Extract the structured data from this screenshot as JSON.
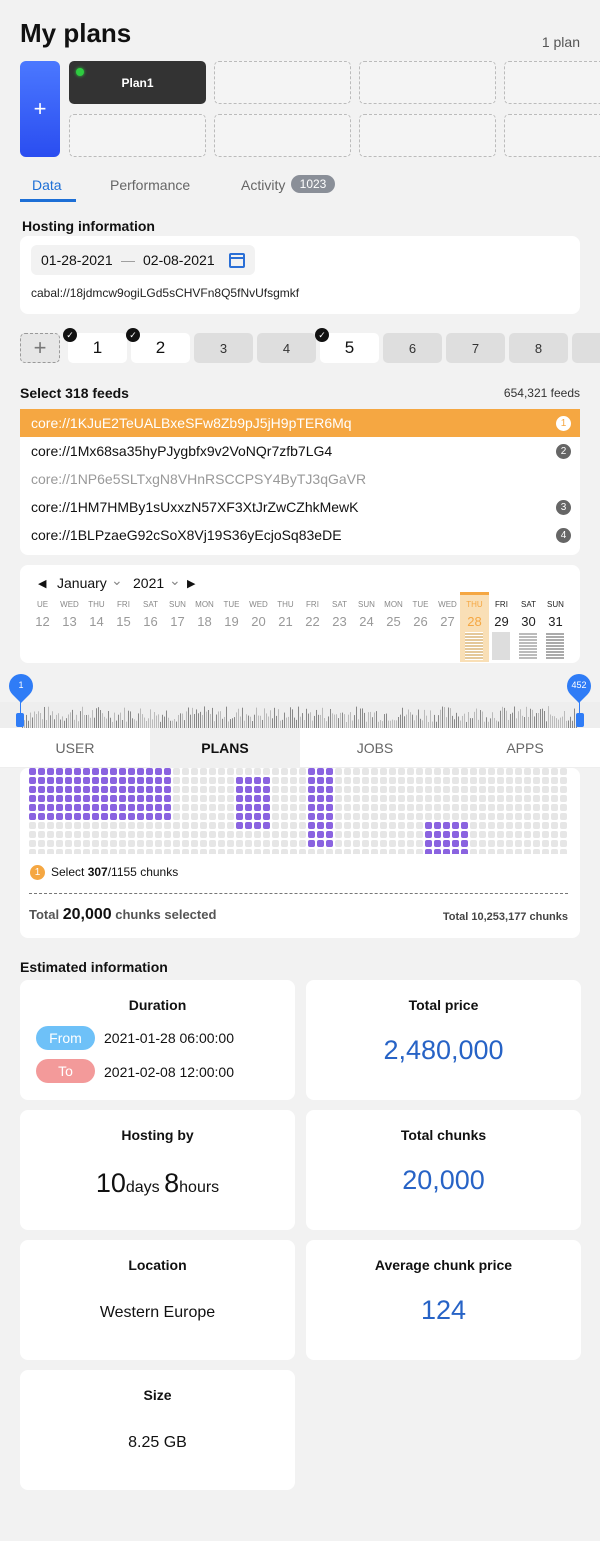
{
  "header": {
    "title": "My plans",
    "count": "1 plan",
    "add_label": "+"
  },
  "plans": {
    "plan1_label": "Plan1"
  },
  "tabs": [
    {
      "label": "Data"
    },
    {
      "label": "Performance"
    },
    {
      "label": "Activity",
      "badge": "1023"
    }
  ],
  "hosting": {
    "title": "Hosting information",
    "date_from": "01-28-2021",
    "date_sep": "—",
    "date_to": "02-08-2021",
    "address": "cabal://18jdmcw9ogiLGd5sCHVFn8Q5fNvUfsgmkf"
  },
  "feed_buttons": {
    "add": "+",
    "labels": [
      "1",
      "2",
      "3",
      "4",
      "5",
      "6",
      "7",
      "8"
    ],
    "checked": [
      true,
      true,
      false,
      false,
      true,
      false,
      false,
      false
    ],
    "check_mark": "✓"
  },
  "feeds": {
    "title": "Select 318 feeds",
    "count": "654,321 feeds",
    "rows": [
      {
        "address": "core://1KJuE2TeUALBxeSFw8Zb9pJ5jH9pTER6Mq",
        "num": "1"
      },
      {
        "address": "core://1Mx68sa35hyPJygbfx9v2VoNQr7zfb7LG4",
        "num": "2"
      },
      {
        "address": "core://1NP6e5SLTxgN8VHnRSCCPSY4ByTJ3qGaVR",
        "num": ""
      },
      {
        "address": "core://1HM7HMBy1sUxxzN57XF3XtJrZwCZhkMewK",
        "num": "3"
      },
      {
        "address": "core://1BLPzaeG92cSoX8Vj19S36yEcjoSq83eDE",
        "num": "4"
      }
    ]
  },
  "calendar": {
    "prev": "◀",
    "next": "▶",
    "month": "January",
    "year": "2021",
    "caret": "⌄",
    "days": [
      {
        "dn": "UE",
        "dd": "12"
      },
      {
        "dn": "WED",
        "dd": "13"
      },
      {
        "dn": "THU",
        "dd": "14"
      },
      {
        "dn": "FRI",
        "dd": "15"
      },
      {
        "dn": "SAT",
        "dd": "16"
      },
      {
        "dn": "SUN",
        "dd": "17"
      },
      {
        "dn": "MON",
        "dd": "18"
      },
      {
        "dn": "TUE",
        "dd": "19"
      },
      {
        "dn": "WED",
        "dd": "20"
      },
      {
        "dn": "THU",
        "dd": "21"
      },
      {
        "dn": "FRI",
        "dd": "22"
      },
      {
        "dn": "SAT",
        "dd": "23"
      },
      {
        "dn": "SUN",
        "dd": "24"
      },
      {
        "dn": "MON",
        "dd": "25"
      },
      {
        "dn": "TUE",
        "dd": "26"
      },
      {
        "dn": "WED",
        "dd": "27"
      },
      {
        "dn": "THU",
        "dd": "28"
      },
      {
        "dn": "FRI",
        "dd": "29"
      },
      {
        "dn": "SAT",
        "dd": "30"
      },
      {
        "dn": "SUN",
        "dd": "31"
      }
    ]
  },
  "slider": {
    "start": "1",
    "end": "452"
  },
  "bottom_tabs": [
    "USER",
    "PLANS",
    "JOBS",
    "APPS"
  ],
  "chunks": {
    "select_num": "1",
    "select_prefix": "Select ",
    "selected": "307",
    "select_suffix": "/1155 chunks",
    "total_left_prefix": "Total ",
    "total_left_value": "20,000",
    "total_left_suffix": " chunks selected",
    "total_right": "Total 10,253,177 chunks"
  },
  "estimated": {
    "title": "Estimated information",
    "duration": {
      "title": "Duration",
      "from_label": "From",
      "from": "2021-01-28 06:00:00",
      "to_label": "To",
      "to": "2021-02-08 12:00:00"
    },
    "total_price": {
      "title": "Total price",
      "value": "2,480,000"
    },
    "hosting_by": {
      "title": "Hosting by",
      "days": "10",
      "days_unit": "days",
      "hours": "8",
      "hours_unit": "hours"
    },
    "total_chunks": {
      "title": "Total chunks",
      "value": "20,000"
    },
    "location": {
      "title": "Location",
      "value": "Western Europe"
    },
    "avg_price": {
      "title": "Average chunk price",
      "value": "124"
    },
    "size": {
      "title": "Size",
      "value": "8.25 GB"
    }
  },
  "colors": {
    "accent": "#1d6fd6",
    "selected_feed": "#f5a742",
    "chunk_selected": "#8a63e0",
    "chunk_empty": "#e6e6e6"
  }
}
